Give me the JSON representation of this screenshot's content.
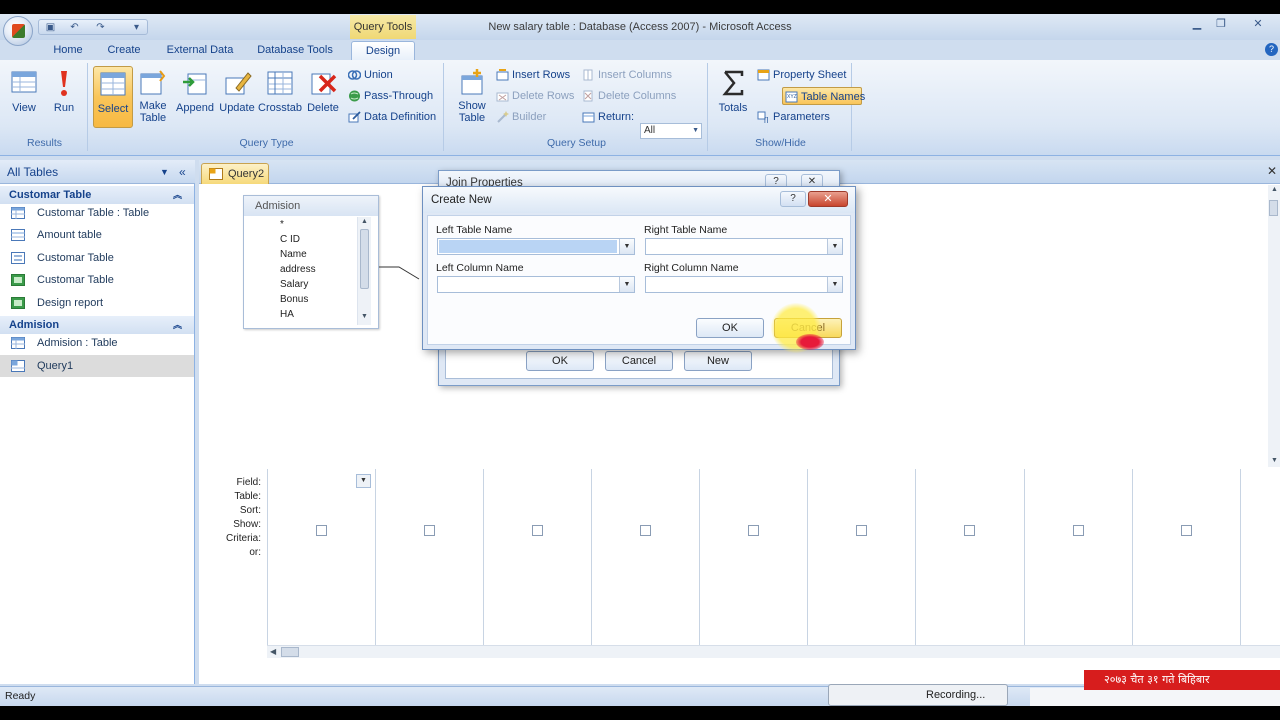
{
  "window": {
    "contextual_tab": "Query Tools",
    "title": "New salary table : Database (Access 2007) - Microsoft Access"
  },
  "tabs": [
    "Home",
    "Create",
    "External Data",
    "Database Tools",
    "Design"
  ],
  "active_tab": "Design",
  "ribbon": {
    "results": {
      "label": "Results",
      "view": "View",
      "run": "Run"
    },
    "query_type": {
      "label": "Query Type",
      "select": "Select",
      "make_table_1": "Make",
      "make_table_2": "Table",
      "append": "Append",
      "update": "Update",
      "crosstab": "Crosstab",
      "delete": "Delete",
      "union": "Union",
      "pass_through": "Pass-Through",
      "data_definition": "Data Definition"
    },
    "query_setup": {
      "label": "Query Setup",
      "show_table_1": "Show",
      "show_table_2": "Table",
      "insert_rows": "Insert Rows",
      "delete_rows": "Delete Rows",
      "builder": "Builder",
      "insert_columns": "Insert Columns",
      "delete_columns": "Delete Columns",
      "return_label": "Return:",
      "return_value": "All"
    },
    "show_hide": {
      "label": "Show/Hide",
      "totals": "Totals",
      "property_sheet": "Property Sheet",
      "table_names": "Table Names",
      "parameters": "Parameters"
    }
  },
  "nav": {
    "header": "All Tables",
    "groups": [
      {
        "name": "Customar Table",
        "items": [
          "Customar Table : Table",
          "Amount table",
          "Customar Table",
          "Customar Table",
          "Design report"
        ]
      },
      {
        "name": "Admision",
        "items": [
          "Admision : Table",
          "Query1"
        ]
      }
    ]
  },
  "document": {
    "tab": "Query2",
    "table_box": {
      "title": "Admision",
      "fields": [
        "*",
        "C ID",
        "Name",
        "address",
        "Salary",
        "Bonus",
        "HA"
      ]
    },
    "grid_labels": [
      "Field:",
      "Table:",
      "Sort:",
      "Show:",
      "Criteria:",
      "or:"
    ]
  },
  "join_dialog": {
    "title": "Join Properties",
    "ok": "OK",
    "cancel": "Cancel",
    "new": "New"
  },
  "create_dialog": {
    "title": "Create New",
    "left_table_label": "Left Table Name",
    "right_table_label": "Right Table Name",
    "left_column_label": "Left Column Name",
    "right_column_label": "Right Column Name",
    "ok": "OK",
    "cancel": "Cancel"
  },
  "status": {
    "text": "Ready",
    "recording": "Recording...",
    "banner": "२०७३ चैत ३१ गते बिहिबार"
  },
  "colors": {
    "ribbon_bg": "#dce7f5",
    "accent_orange": "#f9c55a",
    "close_red": "#c8452d",
    "text_blue": "#15428b"
  }
}
